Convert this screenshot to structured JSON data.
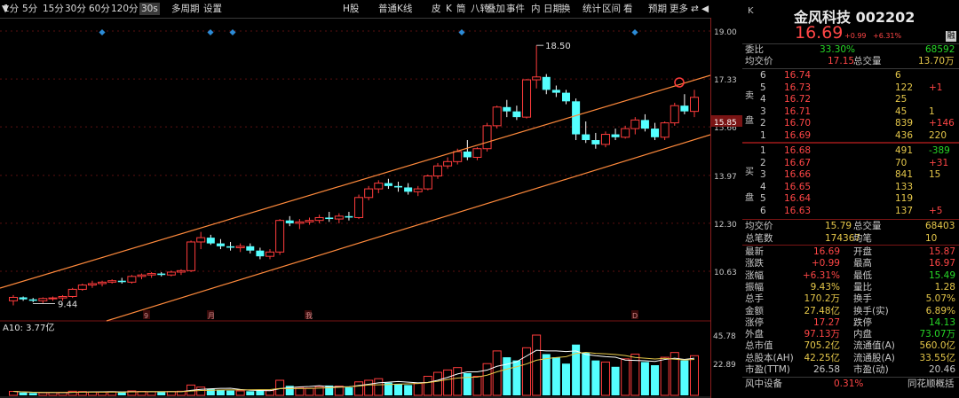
{
  "toolbar": {
    "items": [
      "1分",
      "5分",
      "15分",
      "30分",
      "60分",
      "120分",
      "30s",
      "多周期",
      "设置",
      "H股",
      "普通K线",
      "皮",
      "K",
      "筒",
      "八转",
      "叠加",
      "事件",
      "内",
      "日期",
      "换",
      "统计",
      "区间",
      "看",
      "预期",
      "更多",
      "⇄",
      "◀",
      "▼"
    ],
    "selected": "30s"
  },
  "chart": {
    "y_ticks": [
      "19.00",
      "17.33",
      "15.66",
      "13.97",
      "12.30",
      "10.63"
    ],
    "vol_ticks": [
      "45.78",
      "22.89"
    ],
    "last_price_tag": "15.85",
    "high_label": "18.50",
    "low_label": "9.44",
    "vol_label": "A10: 3.77亿",
    "date_marks": [
      "9",
      "月",
      "我",
      "D"
    ],
    "candles": [
      [
        9.6,
        9.8,
        9.44,
        9.72
      ],
      [
        9.72,
        9.75,
        9.6,
        9.65
      ],
      [
        9.65,
        9.7,
        9.55,
        9.6
      ],
      [
        9.6,
        9.72,
        9.5,
        9.68
      ],
      [
        9.68,
        9.75,
        9.6,
        9.7
      ],
      [
        9.7,
        9.8,
        9.6,
        9.75
      ],
      [
        9.75,
        10.05,
        9.7,
        10.0
      ],
      [
        10.0,
        10.2,
        9.95,
        10.15
      ],
      [
        10.15,
        10.3,
        10.05,
        10.2
      ],
      [
        10.2,
        10.3,
        10.1,
        10.25
      ],
      [
        10.25,
        10.35,
        10.2,
        10.3
      ],
      [
        10.3,
        10.4,
        10.2,
        10.25
      ],
      [
        10.25,
        10.5,
        10.2,
        10.45
      ],
      [
        10.45,
        10.55,
        10.35,
        10.5
      ],
      [
        10.5,
        10.6,
        10.4,
        10.55
      ],
      [
        10.55,
        10.6,
        10.45,
        10.5
      ],
      [
        10.5,
        10.65,
        10.45,
        10.6
      ],
      [
        10.6,
        10.7,
        10.5,
        10.65
      ],
      [
        10.65,
        11.7,
        10.6,
        11.65
      ],
      [
        11.65,
        12.0,
        11.4,
        11.8
      ],
      [
        11.8,
        11.9,
        11.55,
        11.6
      ],
      [
        11.6,
        11.75,
        11.4,
        11.5
      ],
      [
        11.5,
        11.65,
        11.35,
        11.45
      ],
      [
        11.45,
        11.6,
        11.3,
        11.5
      ],
      [
        11.5,
        11.6,
        11.25,
        11.35
      ],
      [
        11.35,
        11.45,
        11.05,
        11.15
      ],
      [
        11.15,
        11.4,
        11.05,
        11.3
      ],
      [
        11.3,
        12.45,
        11.2,
        12.4
      ],
      [
        12.4,
        12.55,
        12.2,
        12.3
      ],
      [
        12.3,
        12.45,
        12.1,
        12.35
      ],
      [
        12.35,
        12.5,
        12.25,
        12.4
      ],
      [
        12.4,
        12.6,
        12.3,
        12.5
      ],
      [
        12.5,
        12.7,
        12.35,
        12.45
      ],
      [
        12.45,
        12.65,
        12.3,
        12.55
      ],
      [
        12.55,
        12.7,
        12.4,
        12.5
      ],
      [
        12.5,
        13.3,
        12.45,
        13.2
      ],
      [
        13.2,
        13.6,
        13.1,
        13.5
      ],
      [
        13.5,
        13.8,
        13.35,
        13.7
      ],
      [
        13.7,
        13.85,
        13.5,
        13.6
      ],
      [
        13.6,
        13.75,
        13.4,
        13.55
      ],
      [
        13.55,
        13.7,
        13.3,
        13.4
      ],
      [
        13.4,
        13.6,
        13.25,
        13.5
      ],
      [
        13.5,
        14.0,
        13.45,
        13.95
      ],
      [
        13.95,
        14.4,
        13.85,
        14.3
      ],
      [
        14.3,
        14.6,
        14.2,
        14.45
      ],
      [
        14.45,
        14.9,
        14.35,
        14.8
      ],
      [
        14.8,
        15.2,
        14.5,
        14.6
      ],
      [
        14.6,
        14.95,
        14.5,
        14.9
      ],
      [
        14.9,
        15.8,
        14.8,
        15.7
      ],
      [
        15.7,
        16.4,
        15.6,
        16.35
      ],
      [
        16.35,
        16.6,
        16.0,
        16.2
      ],
      [
        16.2,
        16.4,
        15.9,
        16.0
      ],
      [
        16.0,
        17.33,
        15.95,
        17.3
      ],
      [
        17.3,
        18.5,
        17.0,
        17.4
      ],
      [
        17.4,
        17.5,
        16.8,
        16.95
      ],
      [
        16.95,
        17.1,
        16.7,
        16.85
      ],
      [
        16.85,
        16.95,
        16.45,
        16.55
      ],
      [
        16.55,
        16.65,
        15.2,
        15.4
      ],
      [
        15.4,
        15.85,
        15.1,
        15.2
      ],
      [
        15.2,
        15.45,
        14.9,
        15.05
      ],
      [
        15.05,
        15.5,
        14.95,
        15.4
      ],
      [
        15.4,
        15.6,
        15.2,
        15.3
      ],
      [
        15.3,
        15.7,
        15.25,
        15.6
      ],
      [
        15.6,
        16.0,
        15.4,
        15.9
      ],
      [
        15.9,
        16.1,
        15.5,
        15.6
      ],
      [
        15.6,
        15.8,
        15.2,
        15.3
      ],
      [
        15.3,
        15.85,
        15.2,
        15.8
      ],
      [
        15.8,
        16.5,
        15.7,
        16.4
      ],
      [
        16.4,
        16.8,
        16.1,
        16.2
      ],
      [
        16.2,
        16.95,
        16.0,
        16.69
      ]
    ],
    "volumes": [
      2.5,
      1.8,
      1.5,
      1.6,
      1.7,
      1.9,
      2.6,
      2.4,
      2.2,
      2.0,
      2.3,
      2.1,
      2.8,
      2.5,
      2.2,
      2.0,
      2.4,
      2.6,
      6.5,
      5.2,
      4.0,
      3.6,
      3.0,
      2.8,
      2.6,
      3.2,
      3.0,
      9.5,
      6.0,
      5.0,
      4.5,
      5.5,
      6.2,
      5.8,
      5.0,
      8.5,
      9.5,
      10.5,
      8.0,
      7.0,
      6.5,
      7.5,
      12.0,
      14.5,
      16.0,
      17.5,
      14.0,
      12.0,
      20.0,
      28.0,
      24.0,
      22.0,
      30.0,
      38.0,
      26.0,
      24.0,
      20.0,
      32.0,
      27.0,
      22.0,
      21.0,
      18.0,
      23.0,
      26.0,
      21.0,
      19.0,
      24.0,
      27.0,
      22.0,
      25.0
    ]
  },
  "stock": {
    "title": "金风科技 002202",
    "price": "16.69",
    "change": "+0.99",
    "pct": "+6.31%",
    "k_label": "K",
    "badge": "融"
  },
  "summary1": {
    "wb_label": "委比",
    "wb": "33.30%",
    "wc": "68592",
    "avg_label": "均交价",
    "avg": "17.15",
    "tv_label": "总交量",
    "tv": "13.70万"
  },
  "asks": [
    {
      "lvl": "6",
      "price": "16.74",
      "vol": "6",
      "chg": ""
    },
    {
      "lvl": "5",
      "price": "16.73",
      "vol": "122",
      "chg": "+1"
    },
    {
      "lvl": "4",
      "price": "16.72",
      "vol": "25",
      "chg": ""
    },
    {
      "lvl": "3",
      "price": "16.71",
      "vol": "45",
      "chg": "1"
    },
    {
      "lvl": "2",
      "price": "16.70",
      "vol": "839",
      "chg": "+146"
    },
    {
      "lvl": "1",
      "price": "16.69",
      "vol": "436",
      "chg": "220"
    }
  ],
  "bids": [
    {
      "lvl": "1",
      "price": "16.68",
      "vol": "491",
      "chg": "-389"
    },
    {
      "lvl": "2",
      "price": "16.67",
      "vol": "70",
      "chg": "+31"
    },
    {
      "lvl": "3",
      "price": "16.66",
      "vol": "841",
      "chg": "15"
    },
    {
      "lvl": "4",
      "price": "16.65",
      "vol": "133",
      "chg": ""
    },
    {
      "lvl": "5",
      "price": "16.64",
      "vol": "119",
      "chg": ""
    },
    {
      "lvl": "6",
      "price": "16.63",
      "vol": "137",
      "chg": "+5"
    }
  ],
  "side_labels": {
    "ask1": "卖",
    "ask2": "盘",
    "bid1": "买",
    "bid2": "盘"
  },
  "summary2": [
    {
      "l1": "均交价",
      "v1": "15.79",
      "l2": "总交量",
      "v2": "68403"
    },
    {
      "l1": "总笔数",
      "v1": "174367",
      "l2": "均笔",
      "v2": "10"
    }
  ],
  "quote": [
    {
      "l1": "最新",
      "v1": "16.69",
      "c1": "r",
      "l2": "开盘",
      "v2": "15.87",
      "c2": "r"
    },
    {
      "l1": "涨跌",
      "v1": "+0.99",
      "c1": "r",
      "l2": "最高",
      "v2": "16.97",
      "c2": "r"
    },
    {
      "l1": "涨幅",
      "v1": "+6.31%",
      "c1": "r",
      "l2": "最低",
      "v2": "15.49",
      "c2": "g"
    },
    {
      "l1": "振幅",
      "v1": "9.43%",
      "c1": "y",
      "l2": "量比",
      "v2": "1.28",
      "c2": "y"
    },
    {
      "l1": "总手",
      "v1": "170.2万",
      "c1": "y",
      "l2": "换手",
      "v2": "5.07%",
      "c2": "y"
    },
    {
      "l1": "金额",
      "v1": "27.48亿",
      "c1": "y",
      "l2": "换手(实)",
      "v2": "6.89%",
      "c2": "y"
    },
    {
      "l1": "涨停",
      "v1": "17.27",
      "c1": "r",
      "l2": "跌停",
      "v2": "14.13",
      "c2": "g"
    },
    {
      "l1": "外盘",
      "v1": "97.13万",
      "c1": "r",
      "l2": "内盘",
      "v2": "73.07万",
      "c2": "g"
    },
    {
      "l1": "总市值",
      "v1": "705.2亿",
      "c1": "y",
      "l2": "流通值(A)",
      "v2": "560.0亿",
      "c2": "y"
    },
    {
      "l1": "总股本(AH)",
      "v1": "42.25亿",
      "c1": "y",
      "l2": "流通股(A)",
      "v2": "33.55亿",
      "c2": "y"
    },
    {
      "l1": "市盈(TTM)",
      "v1": "26.58",
      "c1": "w",
      "l2": "市盈(动)",
      "v2": "20.46",
      "c2": "w"
    }
  ],
  "footer": {
    "l1": "风中设备",
    "v1": "0.31%",
    "l2": "同花顺概括"
  }
}
